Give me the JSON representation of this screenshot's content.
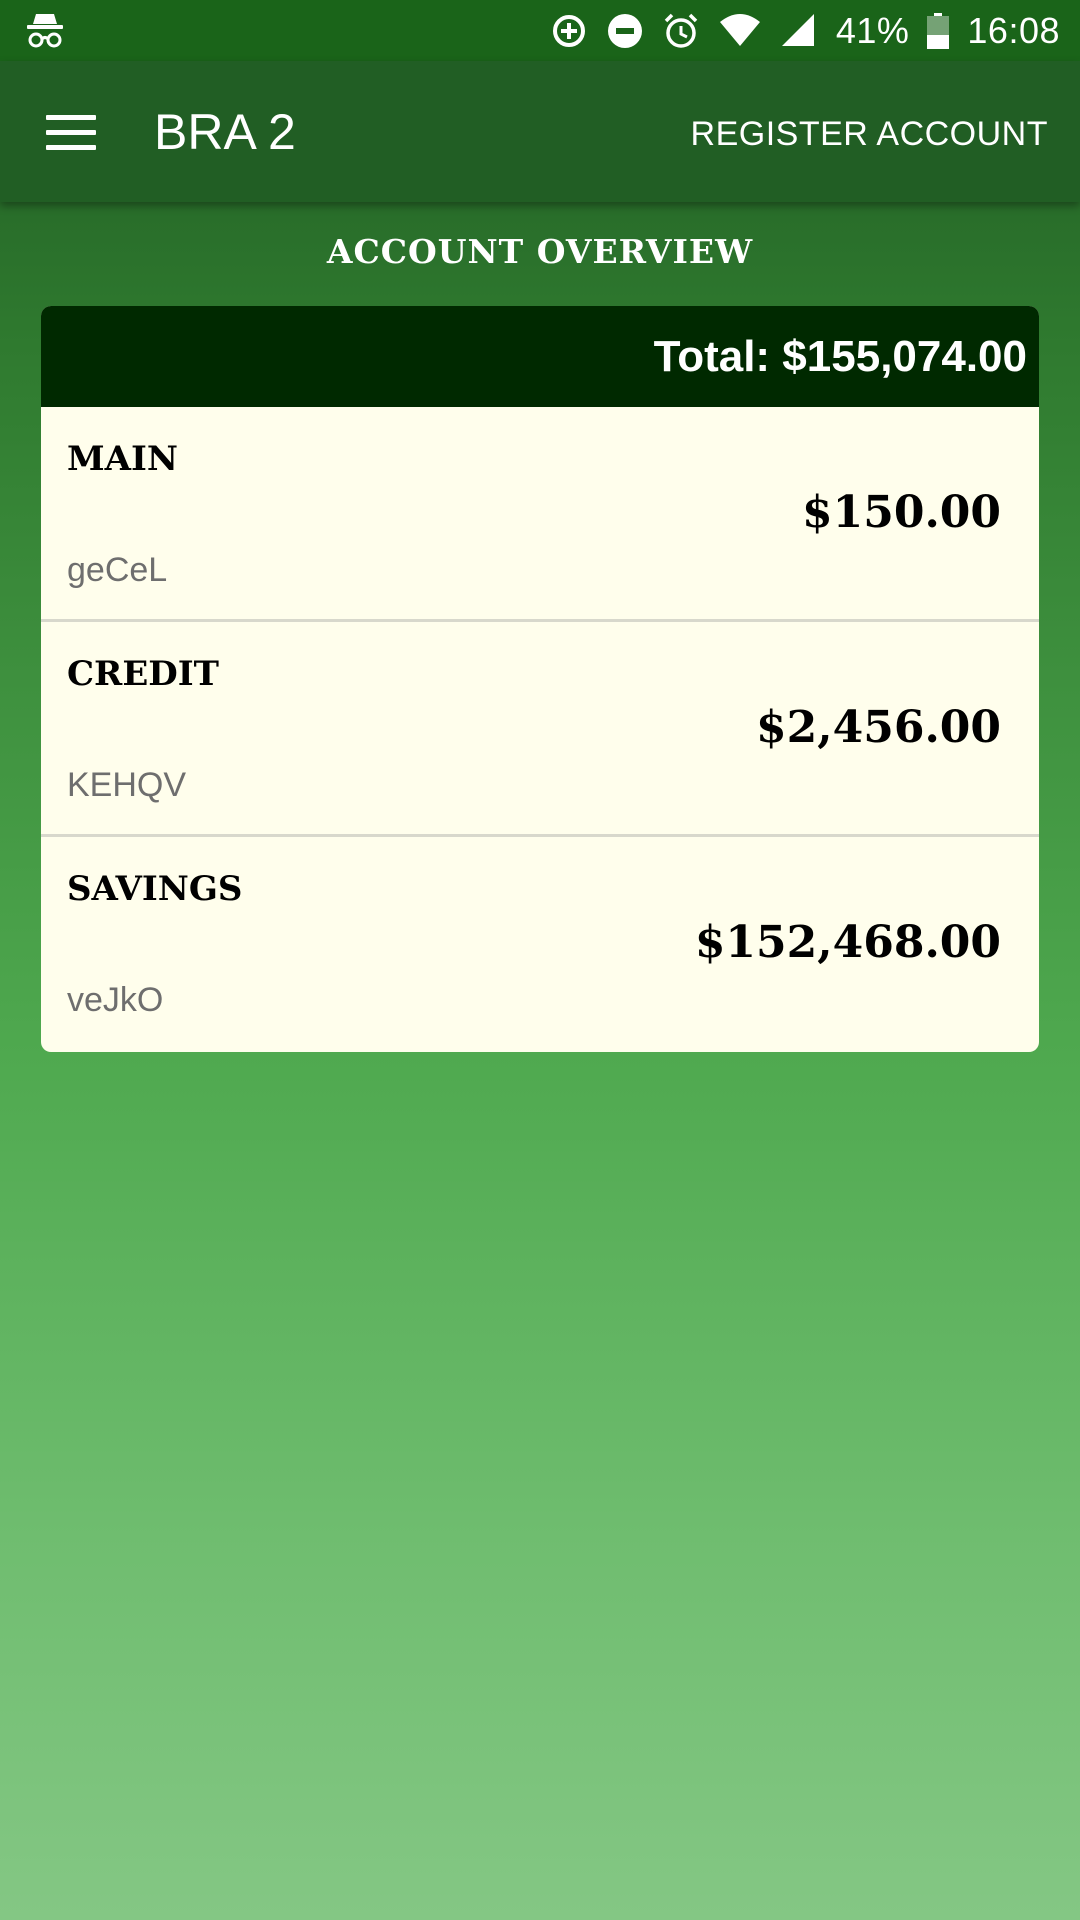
{
  "status_bar": {
    "icons": [
      "incognito-icon",
      "data-saver-icon",
      "do-not-disturb-icon",
      "alarm-icon",
      "wifi-icon",
      "signal-icon",
      "battery-icon"
    ],
    "battery_percent": "41%",
    "time": "16:08"
  },
  "app_bar": {
    "title": "BRA 2",
    "register_label": "REGISTER ACCOUNT"
  },
  "overview": {
    "title": "ACCOUNT OVERVIEW",
    "total": "Total: $155,074.00",
    "accounts": [
      {
        "name": "MAIN",
        "balance": "$150.00",
        "code": "geCeL"
      },
      {
        "name": "CREDIT",
        "balance": "$2,456.00",
        "code": "KEHQV"
      },
      {
        "name": "SAVINGS",
        "balance": "$152,468.00",
        "code": "veJkO"
      }
    ]
  },
  "colors": {
    "status_bar": "#1a6419",
    "app_bar": "#215e24",
    "card_header": "#002900",
    "card_body": "#fffeec"
  }
}
